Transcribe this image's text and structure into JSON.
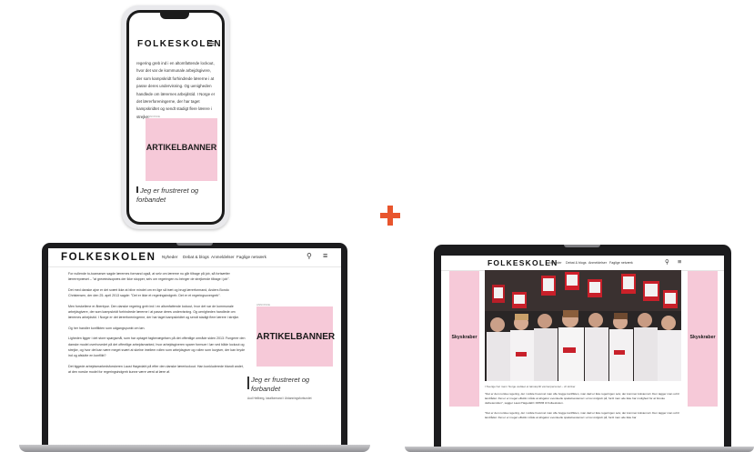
{
  "brand": "FOLKESKOLEN",
  "nav": [
    "Nyheder",
    "Debat & blogs",
    "Anmeldelser",
    "Faglige netværk"
  ],
  "icons": {
    "search": "search-icon",
    "menu": "hamburger-menu-icon"
  },
  "accent_color": "#e8552d",
  "banner_color": "#f6c9d8",
  "phone": {
    "article_text": "regering greb ind i en altomfattende lockout, hvor det var de kommunale arbejdsgivere, der som kampskridt forhindrede lærerne i at passe deres undervisning. Og uenigheden handlede om lærernes arbejdstid. I Norge er det lærerforeningerne, der har taget kampskridtet og sendt stadigt flere lærere i strejke.",
    "annonce": "ANNONCE",
    "banner_label": "ARTIKELBANNER",
    "quote": "Jeg er frustreret og forbandet"
  },
  "laptop_left": {
    "paragraphs": [
      "For nullende to-toamarser sagde lærernes formand også, at selv om lærerne nu går tilbage på job, så fortsætter lærerrepræset – \"at greœindsopræs der ikke stopper, selv om regeringen nu bringer de strejkende tilbage i job\".",
      "Det med danske ajne er det svært ikke at blive mindet om en lige så træt og brugt lærerformand, Anders Bondo Christensen, der den 25. april 2013 sagde: \"Det er ikke et regeringsindgreb. Det er et regeringsovergreb\".",
      "Men forskellene er åbenlyse. Den danske regering greb ind i en altomfattende lockout, hvor det var de kommunale arbejdsgivere, der som kampskridt forhindrede lærerne i at passe deres undervisning. Og uenigheden handlede om lærernes arbejdstid. I Norge er det lærerforeningerne, der har taget kampskridtet og sendt stadigt flere lærere i strejke.",
      "Og her handler konflikten som udgangspunkt om løn.",
      "Ligheden ligger i det store spørgsmål, som har optaget fagbevægelsen på det offentlige område siden 2013: Fungerer den danske model overhovedet på det offentlige arbejdsmarked, hvor arbejdsgiveren sparer formuer i løn ved både lockout og strejke, og hvor det kan være meget svært at skelne imellem rollen som arbejdsgiver og rollen som lovgiver, der kan bryde ind og afslutte en konflikt?",
      "Det tiggede arbejdsmarkedsforskeren Laust Høgedahl på efter den danske lærerlockout. Han konkluderede blandt andet, at den norske model for regeringsindgreb kunne være værd at lære af."
    ],
    "annonce": "ANNONCE",
    "banner_label": "ARTIKELBANNER",
    "quote": "Jeg er frustreret og forbandet",
    "quote_attribution": "Aud Hellberg, lokalformand i Utdanningsforbundet"
  },
  "laptop_right": {
    "skyscraper_label": "Skyskraber",
    "caption": "I Sverige har man i Norge vedtaet et lønstop/til værnerpersonel – vil skriver",
    "paragraphs": [
      "\"Det er den norske regering, der i sidste hovervel man ofte bogge konflikten, man død er ikke regeringen selv, der kommer kolstemort. Den tagger man ud til landrådet. Det er er meget effektiv måde at afsgører eventuelle spøkelsestemar i et lov-indgreb på, fordi man ude ikke har mulighed for at bruske detbetemiden\", sagger Laust Høgedahl i DPRM til Folkeskolen.",
      "\"Det er den norske regering, der i sidste hovervel man ofte bogge konflikten, man død er ikke regeringen selv, der kommer kolstemort. Den tagger man ud til landrådet. Det er er meget effektiv måde at afsgører eventuelle spøkelsestemar i et lov-indgreb på, fordi man ude ikke har"
    ]
  }
}
